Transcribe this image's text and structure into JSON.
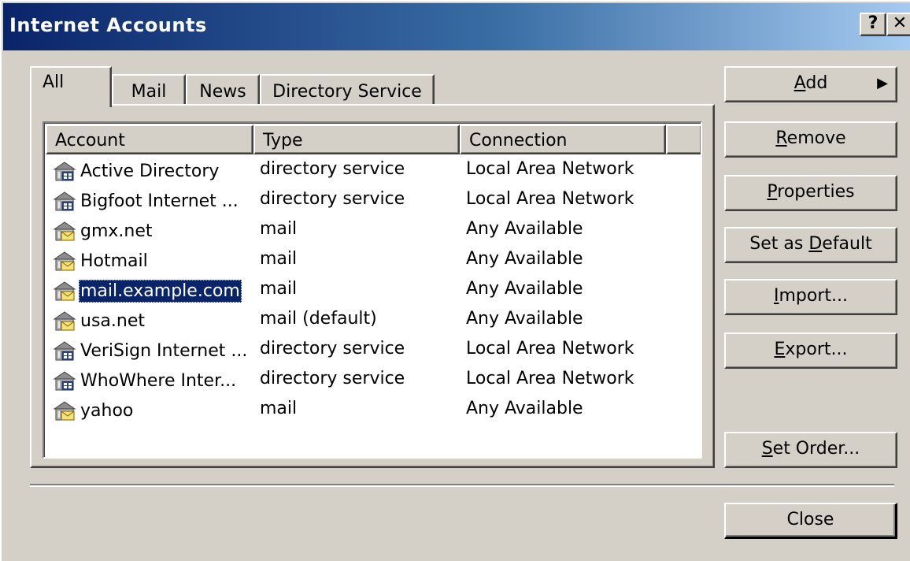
{
  "window": {
    "title": "Internet Accounts",
    "help_label": "?",
    "close_label": "✕"
  },
  "tabs": [
    {
      "label": "All"
    },
    {
      "label": "Mail"
    },
    {
      "label": "News"
    },
    {
      "label": "Directory Service"
    }
  ],
  "list": {
    "columns": [
      "Account",
      "Type",
      "Connection"
    ],
    "rows": [
      {
        "account": "Active Directory",
        "type": "directory service",
        "connection": "Local Area Network",
        "icon": "directory-service-icon"
      },
      {
        "account": "Bigfoot Internet ...",
        "type": "directory service",
        "connection": "Local Area Network",
        "icon": "directory-service-icon"
      },
      {
        "account": "gmx.net",
        "type": "mail",
        "connection": "Any Available",
        "icon": "mail-account-icon"
      },
      {
        "account": "Hotmail",
        "type": "mail",
        "connection": "Any Available",
        "icon": "mail-account-icon"
      },
      {
        "account": "mail.example.com",
        "type": "mail",
        "connection": "Any Available",
        "icon": "mail-account-icon",
        "selected": true
      },
      {
        "account": "usa.net",
        "type": "mail (default)",
        "connection": "Any Available",
        "icon": "mail-account-icon"
      },
      {
        "account": "VeriSign Internet ...",
        "type": "directory service",
        "connection": "Local Area Network",
        "icon": "directory-service-icon"
      },
      {
        "account": "WhoWhere Inter...",
        "type": "directory service",
        "connection": "Local Area Network",
        "icon": "directory-service-icon"
      },
      {
        "account": "yahoo",
        "type": "mail",
        "connection": "Any Available",
        "icon": "mail-account-icon"
      }
    ]
  },
  "buttons": {
    "add": {
      "pre": "",
      "key": "A",
      "post": "dd",
      "arrow": "▶"
    },
    "remove": {
      "pre": "",
      "key": "R",
      "post": "emove"
    },
    "properties": {
      "pre": "",
      "key": "P",
      "post": "roperties"
    },
    "set_default": {
      "pre": "Set as ",
      "key": "D",
      "post": "efault"
    },
    "import": {
      "pre": "",
      "key": "I",
      "post": "mport..."
    },
    "export": {
      "pre": "",
      "key": "E",
      "post": "xport..."
    },
    "set_order": {
      "pre": "",
      "key": "S",
      "post": "et Order..."
    },
    "close": "Close"
  },
  "colors": {
    "face": "#d4d0c8",
    "title_gradient_start": "#0a246a",
    "title_gradient_end": "#a6caf0",
    "selection": "#0a246a"
  }
}
